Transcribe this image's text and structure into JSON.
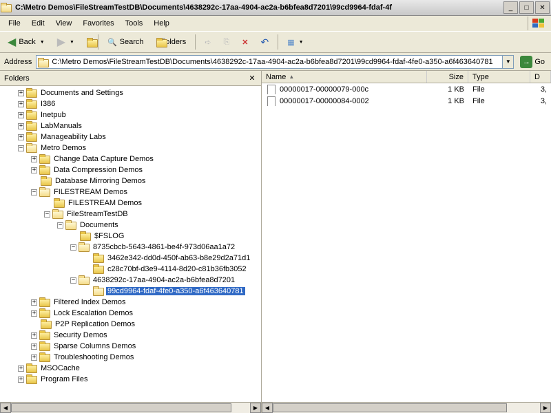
{
  "window": {
    "title": "C:\\Metro Demos\\FileStreamTestDB\\Documents\\4638292c-17aa-4904-ac2a-b6bfea8d7201\\99cd9964-fdaf-4f"
  },
  "menu": {
    "file": "File",
    "edit": "Edit",
    "view": "View",
    "favorites": "Favorites",
    "tools": "Tools",
    "help": "Help"
  },
  "toolbar": {
    "back": "Back",
    "search": "Search",
    "folders": "Folders"
  },
  "addressbar": {
    "label": "Address",
    "path": "C:\\Metro Demos\\FileStreamTestDB\\Documents\\4638292c-17aa-4904-ac2a-b6bfea8d7201\\99cd9964-fdaf-4fe0-a350-a6f463640781",
    "go": "Go"
  },
  "folders_pane": {
    "title": "Folders"
  },
  "tree": {
    "docs_settings": "Documents and Settings",
    "i386": "I386",
    "inetpub": "Inetpub",
    "labmanuals": "LabManuals",
    "manageability": "Manageability Labs",
    "metro": "Metro Demos",
    "cdc": "Change Data Capture Demos",
    "datacomp": "Data Compression Demos",
    "dbmirror": "Database Mirroring Demos",
    "fsdemos": "FILESTREAM Demos",
    "fsdemos2": "FILESTREAM Demos",
    "fstestdb": "FileStreamTestDB",
    "documents": "Documents",
    "fslog": "$FSLOG",
    "guid1": "8735cbcb-5643-4861-be4f-973d06aa1a72",
    "guid1a": "3462e342-dd0d-450f-ab63-b8e29d2a71d1",
    "guid1b": "c28c70bf-d3e9-4114-8d20-c81b36fb3052",
    "guid2": "4638292c-17aa-4904-ac2a-b6bfea8d7201",
    "guid2a": "99cd9964-fdaf-4fe0-a350-a6f463640781",
    "filtered": "Filtered Index Demos",
    "lockesc": "Lock Escalation Demos",
    "p2p": "P2P Replication Demos",
    "security": "Security Demos",
    "sparse": "Sparse Columns Demos",
    "trouble": "Troubleshooting Demos",
    "msocache": "MSOCache",
    "progfiles": "Program Files"
  },
  "list": {
    "cols": {
      "name": "Name",
      "size": "Size",
      "type": "Type",
      "date": "D"
    },
    "rows": [
      {
        "name": "00000017-00000079-000c",
        "size": "1 KB",
        "type": "File",
        "date": "3,"
      },
      {
        "name": "00000017-00000084-0002",
        "size": "1 KB",
        "type": "File",
        "date": "3,"
      }
    ]
  }
}
